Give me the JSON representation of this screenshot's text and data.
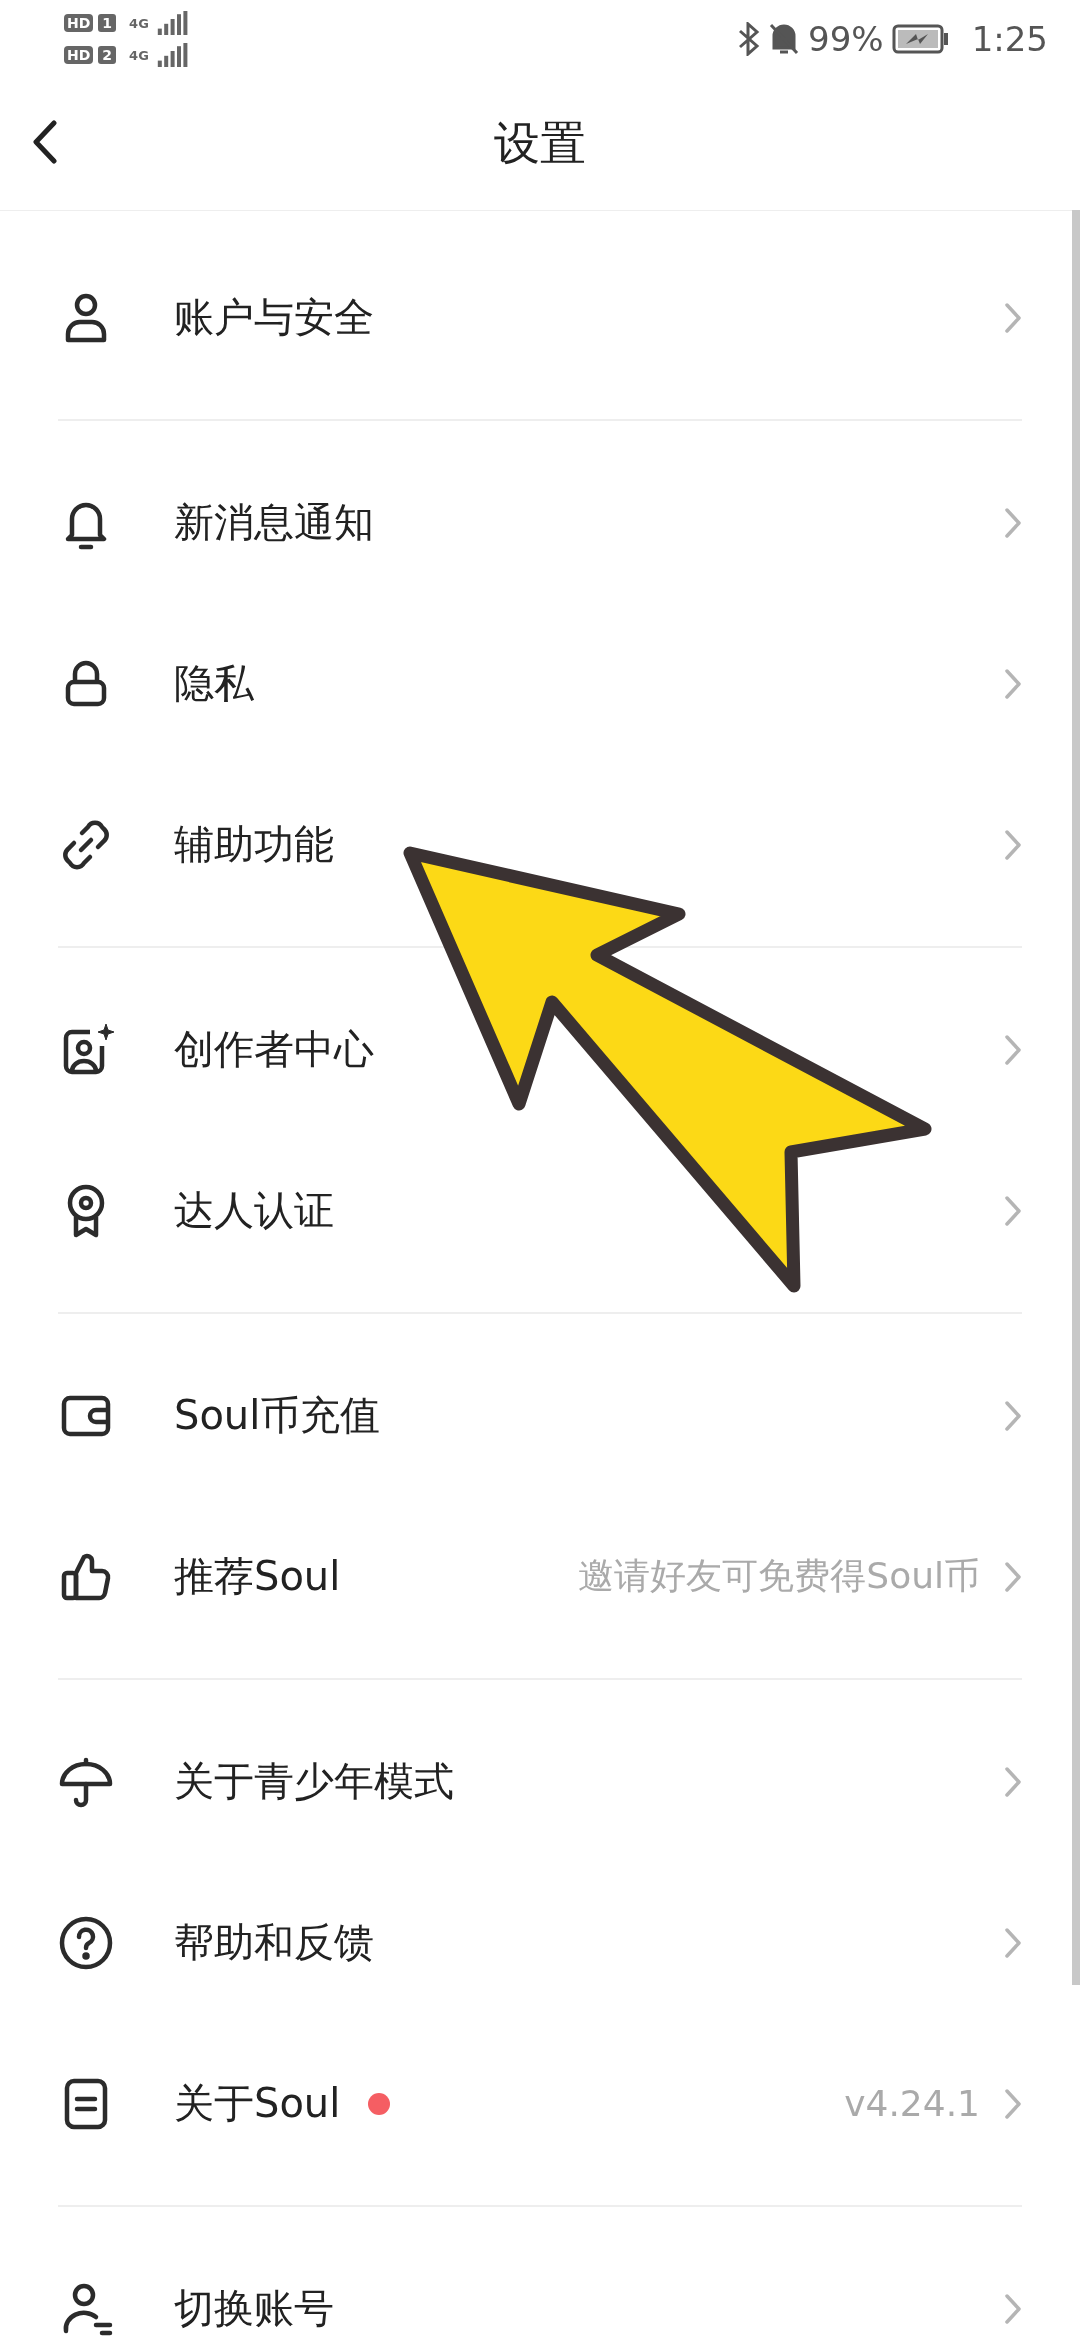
{
  "status_bar": {
    "sims": [
      {
        "hd": "HD",
        "slot": "1",
        "network": "4G"
      },
      {
        "hd": "HD",
        "slot": "2",
        "network": "4G"
      }
    ],
    "battery": "99%",
    "time": "1:25"
  },
  "header": {
    "title": "设置"
  },
  "groups": [
    {
      "items": [
        {
          "kind": "person",
          "label": "账户与安全"
        }
      ]
    },
    {
      "items": [
        {
          "kind": "bell",
          "label": "新消息通知"
        },
        {
          "kind": "lock",
          "label": "隐私"
        },
        {
          "kind": "link",
          "label": "辅助功能"
        }
      ]
    },
    {
      "items": [
        {
          "kind": "creator",
          "label": "创作者中心"
        },
        {
          "kind": "medal",
          "label": "达人认证"
        }
      ]
    },
    {
      "items": [
        {
          "kind": "wallet",
          "label": "Soul币充值"
        },
        {
          "kind": "thumb",
          "label": "推荐Soul",
          "hint": "邀请好友可免费得Soul币"
        }
      ]
    },
    {
      "items": [
        {
          "kind": "umbrella",
          "label": "关于青少年模式"
        },
        {
          "kind": "help",
          "label": "帮助和反馈"
        },
        {
          "kind": "doc",
          "label": "关于Soul",
          "color": "#f55e63",
          "hint": "v4.24.1"
        }
      ]
    },
    {
      "items": [
        {
          "kind": "switch",
          "label": "切换账号"
        }
      ]
    }
  ]
}
